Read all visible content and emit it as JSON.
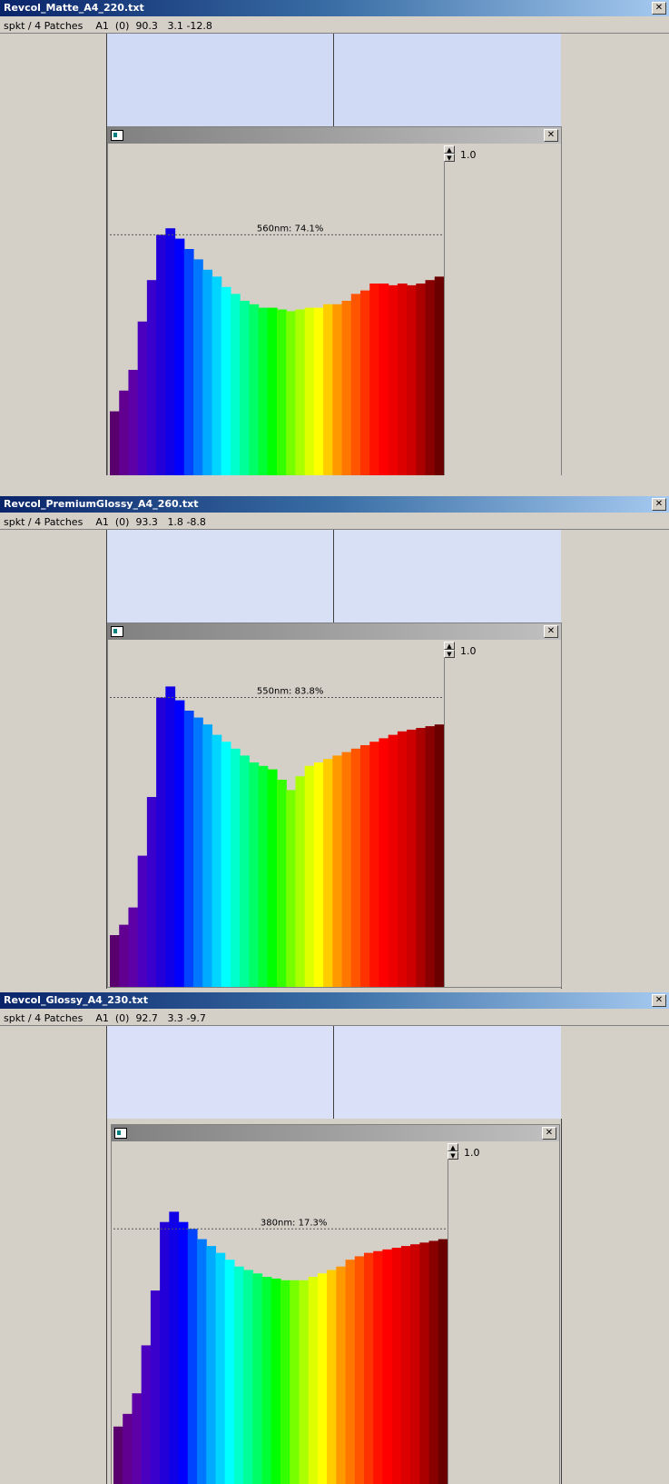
{
  "windows": [
    {
      "title": "Revcol_Matte_A4_220.txt",
      "close": "✕",
      "status": {
        "source": "spkt / 4 Patches",
        "patch": "A1",
        "index": "(0)",
        "L": "90.3",
        "a": "3.1",
        "b": "-12.8"
      },
      "patch_color": "#d0daf5",
      "subwindow": {
        "close": "✕",
        "scale_value": "1.0",
        "spin_up": "▲",
        "spin_down": "▼"
      },
      "chart_data": {
        "type": "bar",
        "x": [
          380,
          390,
          400,
          410,
          420,
          430,
          440,
          450,
          460,
          470,
          480,
          490,
          500,
          510,
          520,
          530,
          540,
          550,
          560,
          570,
          580,
          590,
          600,
          610,
          620,
          630,
          640,
          650,
          660,
          670,
          680,
          690,
          700,
          710,
          720,
          730
        ],
        "values": [
          23.0,
          29.0,
          35.0,
          49.0,
          61.0,
          74.1,
          76.0,
          73.0,
          70.0,
          67.0,
          64.0,
          62.0,
          59.0,
          57.0,
          55.0,
          54.0,
          53.0,
          53.0,
          52.5,
          52.0,
          52.5,
          53.0,
          53.0,
          54.0,
          54.0,
          55.0,
          57.0,
          58.0,
          60.0,
          60.0,
          59.5,
          60.0,
          59.5,
          60.0,
          61.0,
          62.0
        ],
        "marker_label": "560nm: 74.1%",
        "marker_y": 74.1,
        "ylim": [
          0,
          100
        ],
        "colors": [
          "#5a006e",
          "#610090",
          "#5e00a8",
          "#4b00c0",
          "#3a00cc",
          "#2300d8",
          "#1000e8",
          "#0000ff",
          "#0044ff",
          "#0077ff",
          "#00aaff",
          "#00d4ff",
          "#00ffff",
          "#00ffcc",
          "#00ff99",
          "#00ff66",
          "#00ff33",
          "#00ff00",
          "#33ff00",
          "#77ff00",
          "#aaff00",
          "#ddff00",
          "#ffff00",
          "#ffcc00",
          "#ff9900",
          "#ff7700",
          "#ff5500",
          "#ff3300",
          "#ff1100",
          "#ff0000",
          "#ee0000",
          "#dd0000",
          "#cc0000",
          "#aa0000",
          "#880000",
          "#6a0000"
        ]
      }
    },
    {
      "title": "Revcol_PremiumGlossy_A4_260.txt",
      "close": "✕",
      "status": {
        "source": "spkt / 4 Patches",
        "patch": "A1",
        "index": "(0)",
        "L": "93.3",
        "a": "1.8",
        "b": "-8.8"
      },
      "patch_color": "#d8e0f6",
      "subwindow": {
        "close": "✕",
        "scale_value": "1.0",
        "spin_up": "▲",
        "spin_down": "▼"
      },
      "chart_data": {
        "type": "bar",
        "x": [
          380,
          390,
          400,
          410,
          420,
          430,
          440,
          450,
          460,
          470,
          480,
          490,
          500,
          510,
          520,
          530,
          540,
          550,
          560,
          570,
          580,
          590,
          600,
          610,
          620,
          630,
          640,
          650,
          660,
          670,
          680,
          690,
          700,
          710,
          720,
          730
        ],
        "values": [
          15.0,
          18.0,
          23.0,
          38.0,
          55.0,
          83.8,
          87.0,
          83.0,
          80.0,
          78.0,
          76.0,
          73.0,
          71.0,
          69.0,
          67.0,
          65.0,
          64.0,
          63.0,
          60.0,
          57.0,
          61.0,
          64.0,
          65.0,
          66.0,
          67.0,
          68.0,
          69.0,
          70.0,
          71.0,
          72.0,
          73.0,
          74.0,
          74.5,
          75.0,
          75.5,
          76.0
        ],
        "marker_label": "550nm: 83.8%",
        "marker_y": 83.8,
        "ylim": [
          0,
          100
        ],
        "colors": [
          "#5a006e",
          "#610090",
          "#5e00a8",
          "#4b00c0",
          "#3a00cc",
          "#2300d8",
          "#1000e8",
          "#0000ff",
          "#0044ff",
          "#0077ff",
          "#00aaff",
          "#00d4ff",
          "#00ffff",
          "#00ffcc",
          "#00ff99",
          "#00ff66",
          "#00ff33",
          "#00ff00",
          "#33ff00",
          "#77ff00",
          "#aaff00",
          "#ddff00",
          "#ffff00",
          "#ffcc00",
          "#ff9900",
          "#ff7700",
          "#ff5500",
          "#ff3300",
          "#ff1100",
          "#ff0000",
          "#ee0000",
          "#dd0000",
          "#cc0000",
          "#aa0000",
          "#880000",
          "#6a0000"
        ]
      }
    },
    {
      "title": "Revcol_Glossy_A4_230.txt",
      "close": "✕",
      "status": {
        "source": "spkt / 4 Patches",
        "patch": "A1",
        "index": "(0)",
        "L": "92.7",
        "a": "3.3",
        "b": "-9.7"
      },
      "patch_color": "#dae0f8",
      "subwindow": {
        "close": "✕",
        "scale_value": "1.0",
        "spin_up": "▲",
        "spin_down": "▼"
      },
      "chart_data": {
        "type": "bar",
        "x": [
          380,
          390,
          400,
          410,
          420,
          430,
          440,
          450,
          460,
          470,
          480,
          490,
          500,
          510,
          520,
          530,
          540,
          550,
          560,
          570,
          580,
          590,
          600,
          610,
          620,
          630,
          640,
          650,
          660,
          670,
          680,
          690,
          700,
          710,
          720,
          730
        ],
        "values": [
          17.3,
          21.0,
          27.0,
          41.0,
          57.0,
          77.0,
          80.0,
          77.0,
          75.0,
          72.0,
          70.0,
          68.0,
          66.0,
          64.0,
          63.0,
          62.0,
          61.0,
          60.5,
          60.0,
          60.0,
          60.0,
          61.0,
          62.0,
          63.0,
          64.0,
          66.0,
          67.0,
          68.0,
          68.5,
          69.0,
          69.5,
          70.0,
          70.5,
          71.0,
          71.5,
          72.0
        ],
        "marker_label": "380nm: 17.3%",
        "marker_y": 75.0,
        "ylim": [
          0,
          100
        ],
        "colors": [
          "#5a006e",
          "#610090",
          "#5e00a8",
          "#4b00c0",
          "#3a00cc",
          "#2300d8",
          "#1000e8",
          "#0000ff",
          "#0044ff",
          "#0077ff",
          "#00aaff",
          "#00d4ff",
          "#00ffff",
          "#00ffcc",
          "#00ff99",
          "#00ff66",
          "#00ff33",
          "#00ff00",
          "#33ff00",
          "#77ff00",
          "#aaff00",
          "#ddff00",
          "#ffff00",
          "#ffcc00",
          "#ff9900",
          "#ff7700",
          "#ff5500",
          "#ff3300",
          "#ff1100",
          "#ff0000",
          "#ee0000",
          "#dd0000",
          "#cc0000",
          "#aa0000",
          "#880000",
          "#6a0000"
        ]
      }
    }
  ]
}
